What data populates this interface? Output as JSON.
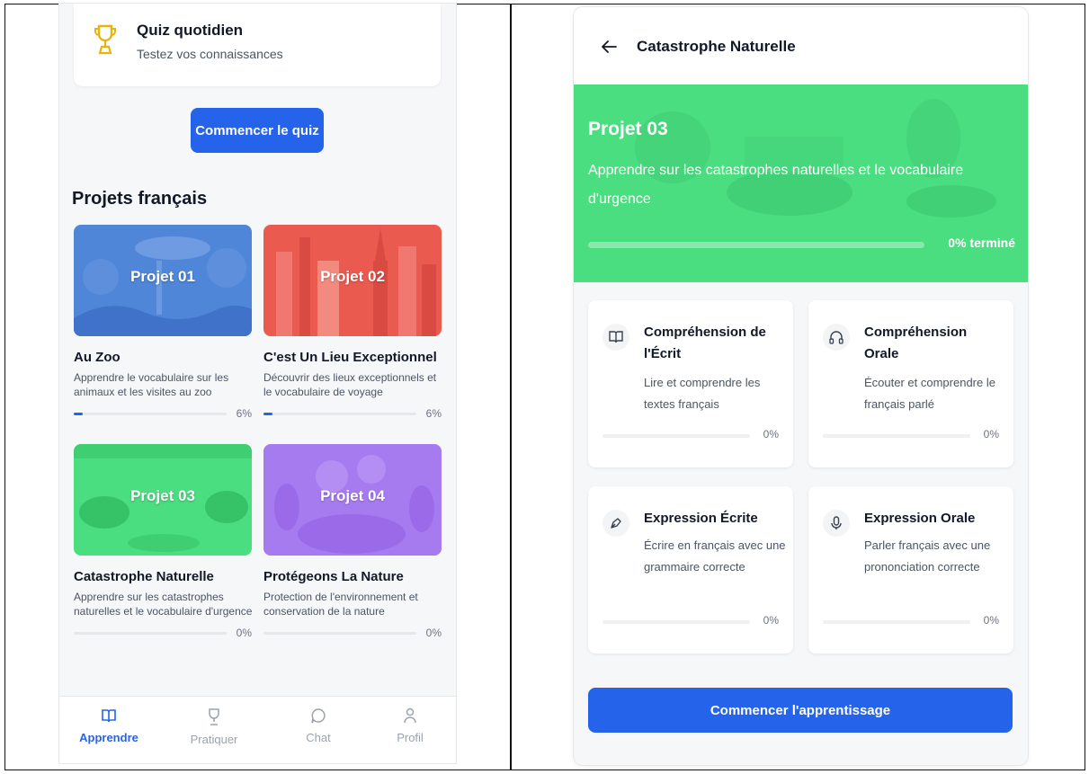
{
  "left": {
    "quiz": {
      "title": "Quiz quotidien",
      "subtitle": "Testez vos connaissances",
      "button": "Commencer le quiz"
    },
    "section_title": "Projets français",
    "projects": [
      {
        "label": "Projet 01",
        "name": "Au Zoo",
        "desc1": "Apprendre le vocabulaire sur les",
        "desc2": "animaux et les visites au zoo",
        "progress": 6,
        "pct": "6%",
        "color": "#4f86d8"
      },
      {
        "label": "Projet 02",
        "name": "C'est Un Lieu Exceptionnel",
        "desc1": "Découvrir des lieux exceptionnels et",
        "desc2": "le vocabulaire de voyage",
        "progress": 6,
        "pct": "6%",
        "color": "#ea5a4f"
      },
      {
        "label": "Projet 03",
        "name": "Catastrophe Naturelle",
        "desc1": "Apprendre sur les catastrophes",
        "desc2": "naturelles et le vocabulaire d'urgence",
        "progress": 0,
        "pct": "0%",
        "color": "#4ade80"
      },
      {
        "label": "Projet 04",
        "name": "Protégeons La Nature",
        "desc1": "Protection de l'environnement et",
        "desc2": "conservation de la nature",
        "progress": 0,
        "pct": "0%",
        "color": "#a77bf0"
      }
    ],
    "nav": [
      {
        "label": "Apprendre",
        "icon": "book-icon",
        "active": true
      },
      {
        "label": "Pratiquer",
        "icon": "trophy-icon",
        "active": false
      },
      {
        "label": "Chat",
        "icon": "chat-icon",
        "active": false
      },
      {
        "label": "Profil",
        "icon": "user-icon",
        "active": false
      }
    ]
  },
  "right": {
    "header_title": "Catastrophe Naturelle",
    "banner": {
      "title": "Projet 03",
      "description": "Apprendre sur les catastrophes naturelles et le vocabulaire d'urgence",
      "progress": 0,
      "progress_text": "0% terminé",
      "color": "#4ade80"
    },
    "skills": [
      {
        "title": "Compréhension de l'Écrit",
        "desc": "Lire et comprendre les textes français",
        "progress": 0,
        "pct": "0%",
        "icon": "book-icon"
      },
      {
        "title": "Compréhension Orale",
        "desc": "Écouter et comprendre le français parlé",
        "progress": 0,
        "pct": "0%",
        "icon": "headphones-icon"
      },
      {
        "title": "Expression Écrite",
        "desc": "Écrire en français avec une grammaire correcte",
        "progress": 0,
        "pct": "0%",
        "icon": "pen-icon"
      },
      {
        "title": "Expression Orale",
        "desc": "Parler français avec une prononciation correcte",
        "progress": 0,
        "pct": "0%",
        "icon": "microphone-icon"
      }
    ],
    "start_button": "Commencer l'apprentissage"
  },
  "colors": {
    "primary": "#2563eb",
    "green": "#4ade80",
    "text": "#111827",
    "muted": "#4b5563"
  }
}
